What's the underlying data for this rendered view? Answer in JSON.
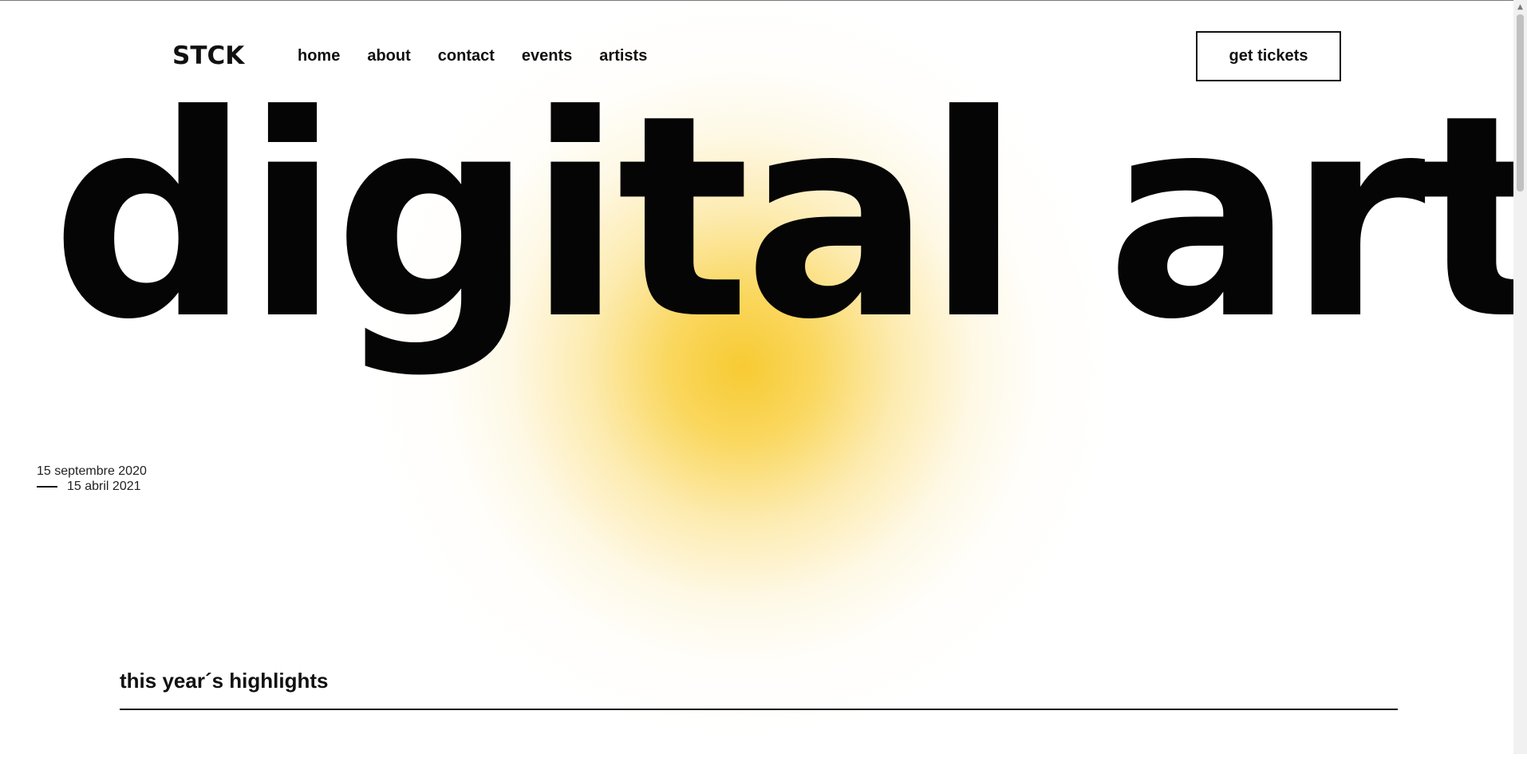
{
  "brand": {
    "logo": "STCK"
  },
  "nav": {
    "items": [
      "home",
      "about",
      "contact",
      "events",
      "artists"
    ]
  },
  "cta": {
    "label": "get tickets"
  },
  "hero": {
    "title": "digital art"
  },
  "dates": {
    "start": "15 septembre 2020",
    "end": "15 abril 2021"
  },
  "highlights": {
    "title": "this year´s highlights"
  },
  "colors": {
    "accent_glow": "#F7C828",
    "text": "#000000",
    "background": "#FFFFFF"
  },
  "icons": {
    "scroll_up": "triangle-up-icon"
  }
}
